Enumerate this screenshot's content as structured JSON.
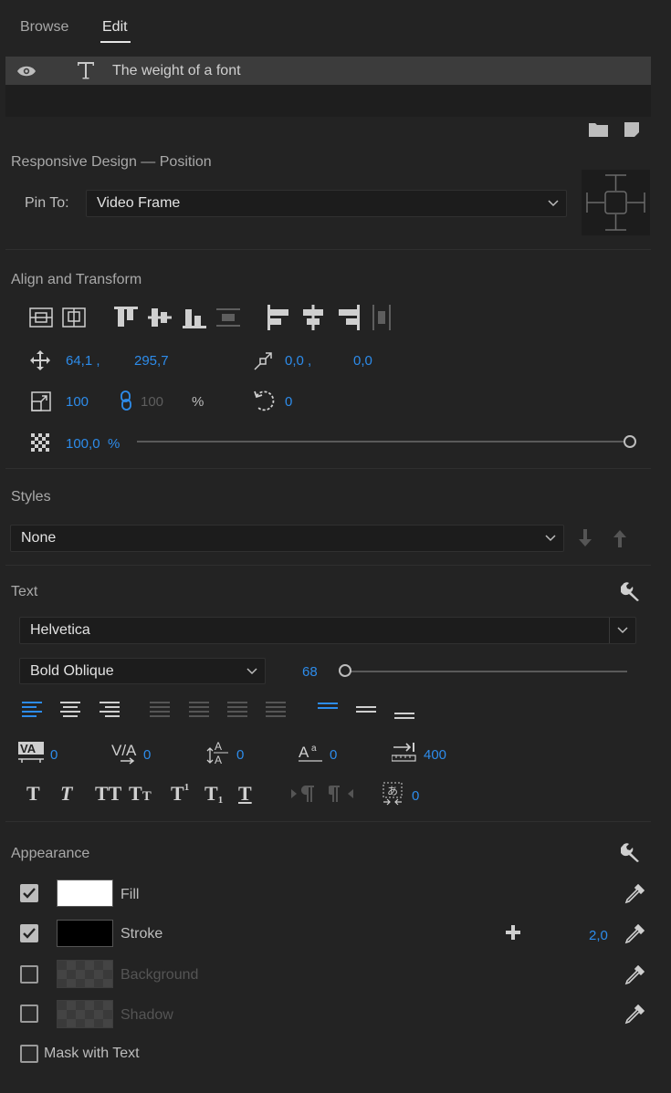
{
  "tabs": [
    {
      "label": "Browse"
    },
    {
      "label": "Edit"
    }
  ],
  "layer": {
    "name": "The weight of a font"
  },
  "responsive": {
    "title": "Responsive Design — Position",
    "pin_label": "Pin To:",
    "pin_value": "Video Frame"
  },
  "align": {
    "title": "Align and Transform",
    "position_x": "64,1 ,",
    "position_y": "295,7",
    "anchor_x": "0,0 ,",
    "anchor_y": "0,0",
    "scale": "100",
    "scale_width": "100",
    "scale_unit": "%",
    "rotation": "0",
    "opacity": "100,0",
    "opacity_unit": "%",
    "opacity_fraction": 1.0
  },
  "styles": {
    "title": "Styles",
    "value": "None"
  },
  "text": {
    "title": "Text",
    "font": "Helvetica",
    "style": "Bold Oblique",
    "size": "68",
    "kerning": "0",
    "tracking": "0",
    "leading": "0",
    "baseline": "0",
    "tab_width": "400",
    "tsume": "0"
  },
  "appearance": {
    "title": "Appearance",
    "fill_label": "Fill",
    "fill_color": "#ffffff",
    "stroke_label": "Stroke",
    "stroke_color": "#000000",
    "stroke_width": "2,0",
    "background_label": "Background",
    "shadow_label": "Shadow",
    "mask_label": "Mask with Text"
  },
  "colors": {
    "accent": "#2d8ceb",
    "panel": "#232323"
  }
}
